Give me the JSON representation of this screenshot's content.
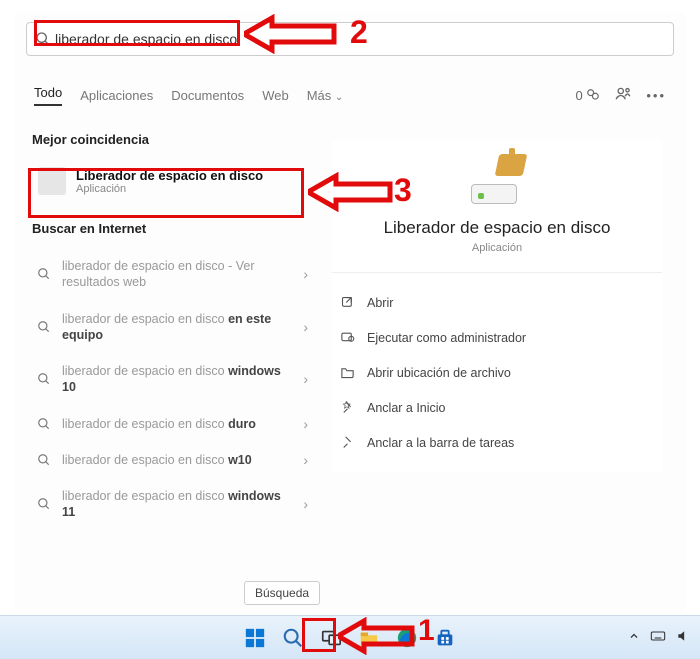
{
  "search": {
    "query": "liberador de espacio en disco"
  },
  "tabs": {
    "all": "Todo",
    "apps": "Aplicaciones",
    "docs": "Documentos",
    "web": "Web",
    "more": "Más",
    "points": "0"
  },
  "left": {
    "best_header": "Mejor coincidencia",
    "best": {
      "title": "Liberador de espacio en disco",
      "subtitle": "Aplicación"
    },
    "web_header": "Buscar en Internet",
    "items": [
      {
        "prefix": "liberador de espacio en disco",
        "suffix": " - Ver resultados web",
        "bold": ""
      },
      {
        "prefix": "liberador de espacio en disco ",
        "suffix": "",
        "bold": "en este equipo"
      },
      {
        "prefix": "liberador de espacio en disco ",
        "suffix": "",
        "bold": "windows 10"
      },
      {
        "prefix": "liberador de espacio en disco ",
        "suffix": "",
        "bold": "duro"
      },
      {
        "prefix": "liberador de espacio en disco ",
        "suffix": "",
        "bold": "w10"
      },
      {
        "prefix": "liberador de espacio en disco ",
        "suffix": "",
        "bold": "windows 11"
      }
    ],
    "busqueda_btn": "Búsqueda"
  },
  "preview": {
    "title": "Liberador de espacio en disco",
    "subtitle": "Aplicación",
    "actions": {
      "open": "Abrir",
      "admin": "Ejecutar como administrador",
      "location": "Abrir ubicación de archivo",
      "pin_start": "Anclar a Inicio",
      "pin_taskbar": "Anclar a la barra de tareas"
    }
  },
  "annotations": {
    "n1": "1",
    "n2": "2",
    "n3": "3"
  }
}
